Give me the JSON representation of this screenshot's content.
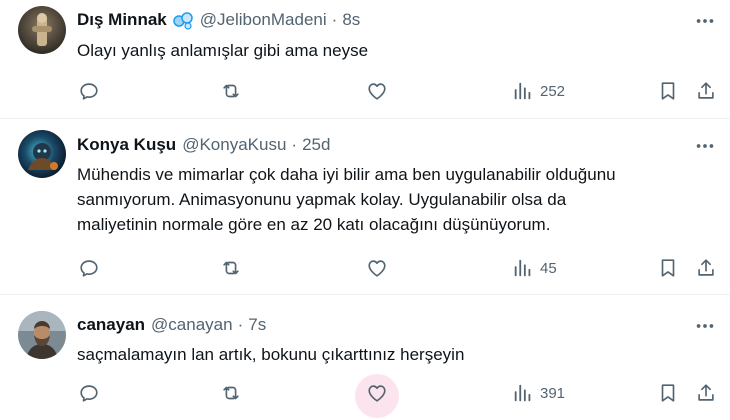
{
  "tweets": [
    {
      "name": "Dış Minnak",
      "handle": "@JelibonMadeni",
      "separator": "·",
      "time": "8s",
      "text_lines": [
        "Olayı yanlış anlamışlar gibi ama neyse"
      ],
      "views": "252",
      "has_badge": true
    },
    {
      "name": "Konya Kuşu",
      "handle": "@KonyaKusu",
      "separator": "·",
      "time": "25d",
      "text_lines": [
        "Mühendis ve mimarlar çok daha iyi bilir ama ben uygulanabilir olduğunu",
        "sanmıyorum. Animasyonunu yapmak kolay. Uygulanabilir olsa da",
        "maliyetinin normale göre en az 20 katı olacağını düşünüyorum."
      ],
      "views": "45",
      "has_badge": false
    },
    {
      "name": "canayan",
      "handle": "@canayan",
      "separator": "·",
      "time": "7s",
      "text_lines": [
        "saçmalamayın lan artık, bokunu çıkarttınız herşeyin"
      ],
      "views": "391",
      "has_badge": false,
      "like_hovered": true
    }
  ],
  "icons": {
    "reply": "reply-icon",
    "retweet": "retweet-icon",
    "like": "heart-icon",
    "views": "analytics-icon",
    "bookmark": "bookmark-icon",
    "share": "share-icon",
    "more": "more-icon"
  },
  "colors": {
    "text": "#0f1419",
    "secondary": "#536471",
    "badge": "#1d9bf0",
    "like_hover_bg": "#fce4ee",
    "divider": "#eff3f4"
  }
}
